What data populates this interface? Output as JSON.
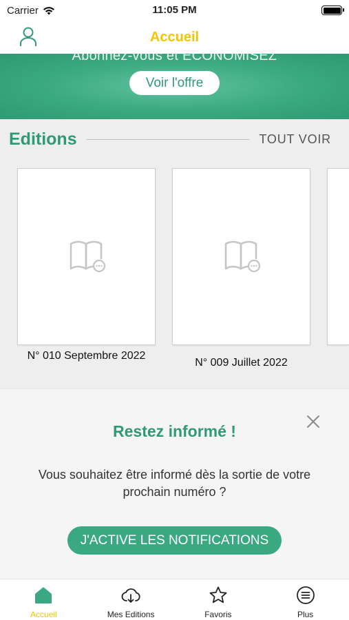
{
  "status_bar": {
    "carrier": "Carrier",
    "time": "11:05 PM"
  },
  "nav": {
    "title": "Accueil",
    "title_color": "#f5c400"
  },
  "banner": {
    "text": "Abonnez-vous et ÉCONOMISEZ",
    "button_label": "Voir l'offre"
  },
  "editions": {
    "title": "Editions",
    "see_all_label": "TOUT VOIR",
    "items": [
      {
        "label": "N° 010 Septembre 2022",
        "icon": "book-icon"
      },
      {
        "label": "N° 009 Juillet 2022",
        "icon": "book-icon"
      },
      {
        "label": "",
        "icon": "book-icon"
      }
    ]
  },
  "notify": {
    "title": "Restez informé !",
    "text": "Vous souhaitez être informé dès la sortie de votre prochain numéro ?",
    "button_label": "J'ACTIVE LES NOTIFICATIONS"
  },
  "tabs": [
    {
      "label": "Accueil",
      "icon": "home-icon",
      "active": true
    },
    {
      "label": "Mes Editions",
      "icon": "cloud-download-icon",
      "active": false
    },
    {
      "label": "Favoris",
      "icon": "star-icon",
      "active": false
    },
    {
      "label": "Plus",
      "icon": "menu-icon",
      "active": false
    }
  ],
  "colors": {
    "accent_green": "#2f9a73",
    "accent_yellow": "#f5c400"
  }
}
